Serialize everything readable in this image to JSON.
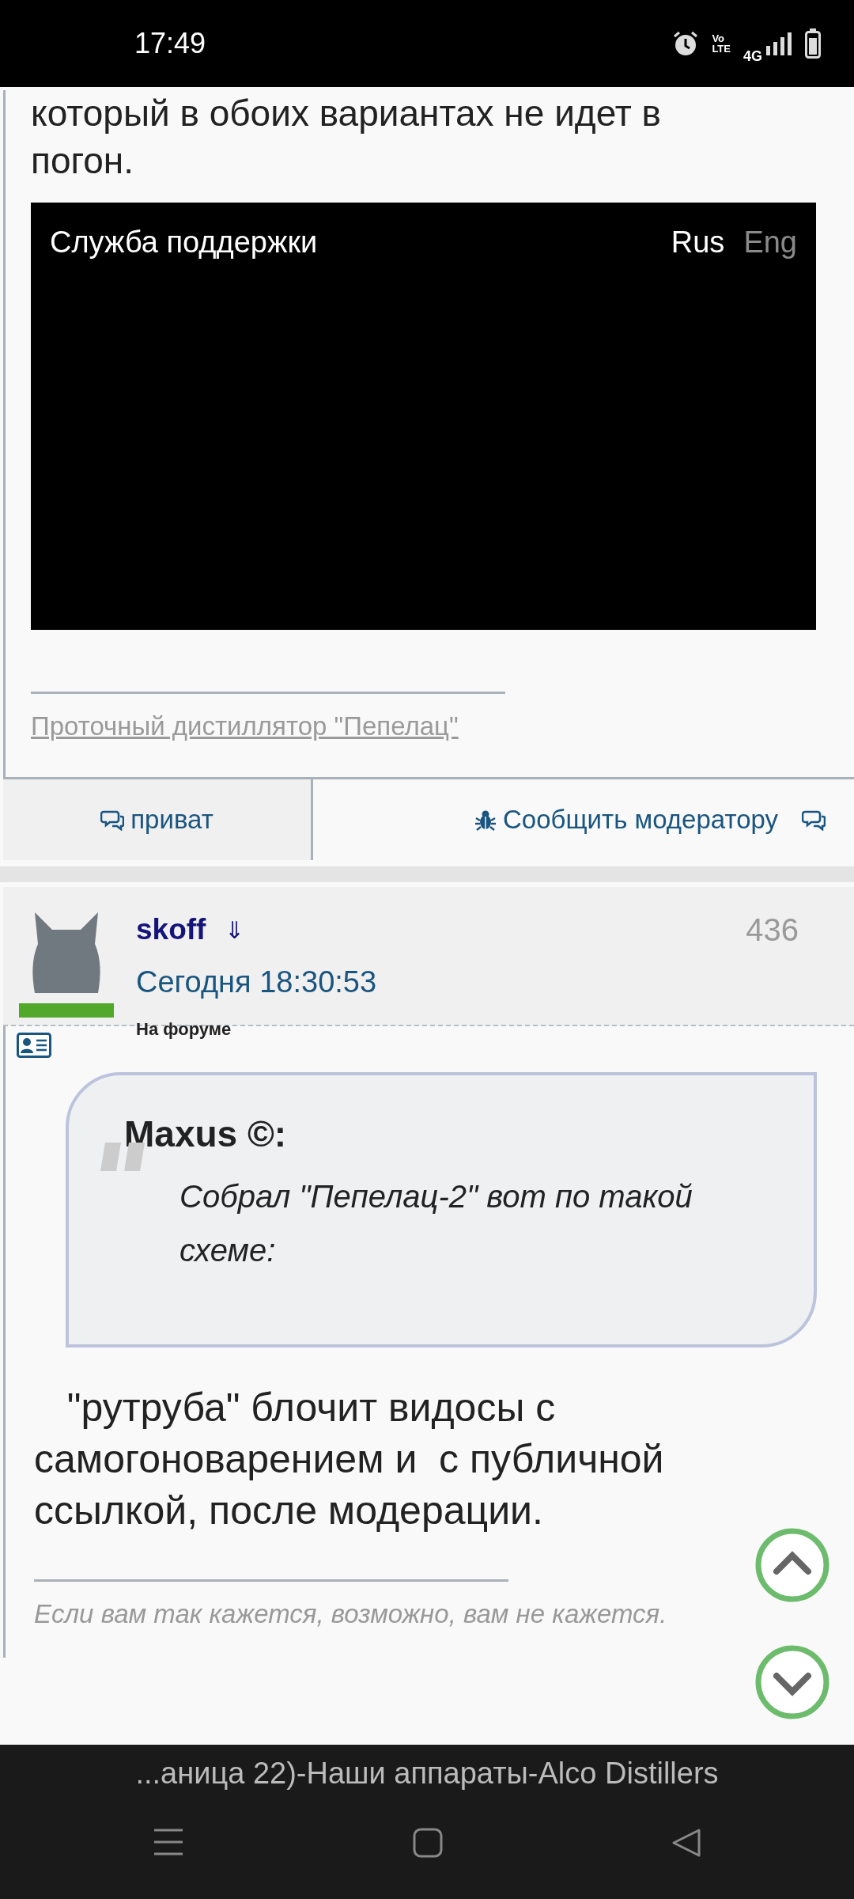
{
  "status_bar": {
    "time": "17:49",
    "volte": [
      "Vo",
      "LTE"
    ],
    "network": "4G"
  },
  "post": {
    "text_lines": [
      "который в обоих вариантах не идет в",
      "погон."
    ],
    "video": {
      "title": "Служба поддержки",
      "languages": [
        {
          "label": "Rus",
          "selected": true
        },
        {
          "label": "Eng",
          "selected": false
        }
      ]
    },
    "signature_link": "Проточный дистиллятор \"Пепелац\"",
    "actions": [
      {
        "kind": "private",
        "label": "приват"
      },
      {
        "kind": "report",
        "label": "Сообщить модератору"
      }
    ]
  },
  "reply": {
    "author": "skoff",
    "sort_arrow": "⇓",
    "number": "436",
    "date": "Сегодня 18:30:53",
    "status": "На форуме",
    "online": true,
    "quote": {
      "author": "Maxus ©:",
      "text": "Собрал \"Пепелац-2\" вот по такой схеме:"
    },
    "text": "   \"рутруба\" блочит видосы с самогоноварением и  с публичной ссылкой, после модерации.",
    "signature": "Если вам так кажется, возможно, вам не кажется."
  },
  "browser_title": "...аница 22)-Наши аппараты-Alco Distillers"
}
